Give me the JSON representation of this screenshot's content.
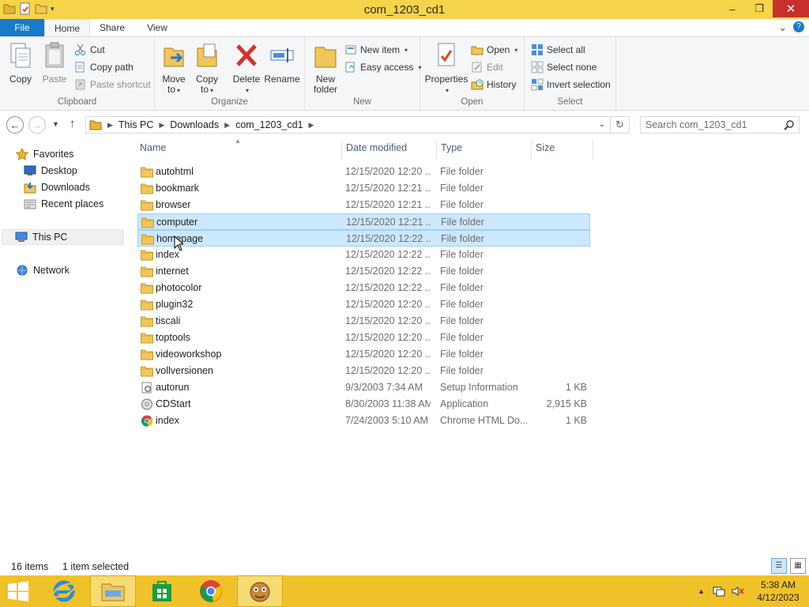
{
  "window": {
    "title": "com_1203_cd1",
    "controls": {
      "minimize": "–",
      "maximize": "❐",
      "close": "✕"
    }
  },
  "ribbon_tabs": {
    "file": "File",
    "home": "Home",
    "share": "Share",
    "view": "View"
  },
  "ribbon": {
    "clipboard": {
      "label": "Clipboard",
      "copy": "Copy",
      "paste": "Paste",
      "cut": "Cut",
      "copy_path": "Copy path",
      "paste_shortcut": "Paste shortcut"
    },
    "organize": {
      "label": "Organize",
      "move_to_1": "Move",
      "move_to_2": "to",
      "copy_to_1": "Copy",
      "copy_to_2": "to",
      "delete": "Delete",
      "rename": "Rename"
    },
    "new": {
      "label": "New",
      "new_folder_1": "New",
      "new_folder_2": "folder",
      "new_item": "New item",
      "easy_access": "Easy access"
    },
    "open": {
      "label": "Open",
      "properties": "Properties",
      "open": "Open",
      "edit": "Edit",
      "history": "History"
    },
    "select": {
      "label": "Select",
      "select_all": "Select all",
      "select_none": "Select none",
      "invert_selection": "Invert selection"
    }
  },
  "address": {
    "crumbs": [
      "This PC",
      "Downloads",
      "com_1203_cd1"
    ],
    "search_placeholder": "Search com_1203_cd1"
  },
  "navpane": {
    "favorites": "Favorites",
    "desktop": "Desktop",
    "downloads": "Downloads",
    "recent": "Recent places",
    "this_pc": "This PC",
    "network": "Network"
  },
  "columns": {
    "name": "Name",
    "date": "Date modified",
    "type": "Type",
    "size": "Size"
  },
  "files": [
    {
      "name": "autohtml",
      "date": "12/15/2020 12:20 ...",
      "type": "File folder",
      "size": "",
      "icon": "folder-icon",
      "selected": false
    },
    {
      "name": "bookmark",
      "date": "12/15/2020 12:21 ...",
      "type": "File folder",
      "size": "",
      "icon": "folder-icon",
      "selected": false
    },
    {
      "name": "browser",
      "date": "12/15/2020 12:21 ...",
      "type": "File folder",
      "size": "",
      "icon": "folder-icon",
      "selected": false
    },
    {
      "name": "computer",
      "date": "12/15/2020 12:21 ...",
      "type": "File folder",
      "size": "",
      "icon": "folder-icon",
      "selected": true
    },
    {
      "name": "homepage",
      "date": "12/15/2020 12:22 ...",
      "type": "File folder",
      "size": "",
      "icon": "folder-icon",
      "selected": true
    },
    {
      "name": "index",
      "date": "12/15/2020 12:22 ...",
      "type": "File folder",
      "size": "",
      "icon": "folder-icon",
      "selected": false
    },
    {
      "name": "internet",
      "date": "12/15/2020 12:22 ...",
      "type": "File folder",
      "size": "",
      "icon": "folder-icon",
      "selected": false
    },
    {
      "name": "photocolor",
      "date": "12/15/2020 12:22 ...",
      "type": "File folder",
      "size": "",
      "icon": "folder-icon",
      "selected": false
    },
    {
      "name": "plugin32",
      "date": "12/15/2020 12:20 ...",
      "type": "File folder",
      "size": "",
      "icon": "folder-icon",
      "selected": false
    },
    {
      "name": "tiscali",
      "date": "12/15/2020 12:20 ...",
      "type": "File folder",
      "size": "",
      "icon": "folder-icon",
      "selected": false
    },
    {
      "name": "toptools",
      "date": "12/15/2020 12:20 ...",
      "type": "File folder",
      "size": "",
      "icon": "folder-icon",
      "selected": false
    },
    {
      "name": "videoworkshop",
      "date": "12/15/2020 12:20 ...",
      "type": "File folder",
      "size": "",
      "icon": "folder-icon",
      "selected": false
    },
    {
      "name": "vollversionen",
      "date": "12/15/2020 12:20 ...",
      "type": "File folder",
      "size": "",
      "icon": "folder-icon",
      "selected": false
    },
    {
      "name": "autorun",
      "date": "9/3/2003 7:34 AM",
      "type": "Setup Information",
      "size": "1 KB",
      "icon": "settings-file-icon",
      "selected": false
    },
    {
      "name": "CDStart",
      "date": "8/30/2003 11:38 AM",
      "type": "Application",
      "size": "2,915 KB",
      "icon": "cd-app-icon",
      "selected": false
    },
    {
      "name": "index",
      "date": "7/24/2003 5:10 AM",
      "type": "Chrome HTML Do...",
      "size": "1 KB",
      "icon": "chrome-icon",
      "selected": false
    }
  ],
  "status": {
    "count": "16 items",
    "selection": "1 item selected"
  },
  "taskbar": {
    "time": "5:38 AM",
    "date": "4/12/2023"
  },
  "colors": {
    "titlebar": "#f5d44a",
    "taskbar": "#f0c229",
    "file_tab": "#1979ca",
    "selection": "#cce8ff",
    "close": "#c7302b"
  }
}
